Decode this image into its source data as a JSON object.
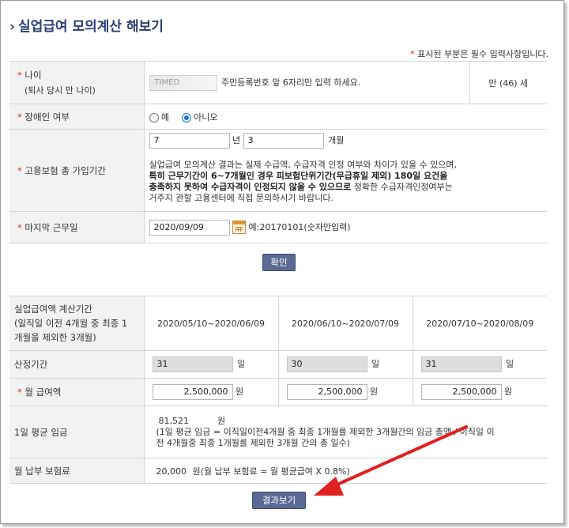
{
  "header": {
    "title": "실업급여 모의계산 해보기",
    "required_note": "표시된 부분은 필수 입력사항입니다."
  },
  "form": {
    "age": {
      "label": "나이",
      "sublabel": "(퇴사 당시 만 나이)",
      "masked_value": "TIMED",
      "help": "주민등록번호 앞 6자리만 입력 하세요.",
      "result": "만 (46) 세"
    },
    "disability": {
      "label": "장애인 여부",
      "options": [
        "예",
        "아니오"
      ],
      "selected": "아니오"
    },
    "insurance_period": {
      "label": "고용보험 총 가입기간",
      "years": "7",
      "years_unit": "년",
      "months": "3",
      "months_unit": "개월",
      "info_plain_1": "실업급여 모의계산 결과는 실제 수급액, 수급자격 인정 여부와 차이가 있을 수 있으며,",
      "info_bold_1": "특히 근무기간이 6~7개월인 경우 피보험단위기간(무급휴일 제외) 180일 요건을",
      "info_bold_2": "충족하지 못하여 수급자격이 인정되지 않을 수 있으므로",
      "info_plain_2": "정확한 수급자격인정여부는",
      "info_plain_3": "거주지 관할 고용센터에 직접 문의하시기 바랍니다."
    },
    "last_workday": {
      "label": "마지막 근무일",
      "value": "2020/09/09",
      "example": "예:20170101(숫자만입력)",
      "calendar_icon": "calendar-icon"
    },
    "confirm_label": "확인"
  },
  "calc": {
    "period_label_1": "실업급여액 계산기간",
    "period_label_2": "(일직일 이전 4개월 중 최종 1",
    "period_label_3": "개월을 제외한 3개월)",
    "periods": [
      "2020/05/10~2020/06/09",
      "2020/06/10~2020/07/09",
      "2020/07/10~2020/08/09"
    ],
    "days_label": "산정기간",
    "days": [
      "31",
      "30",
      "31"
    ],
    "days_unit": "일",
    "wage_label": "월 급여액",
    "wages": [
      "2,500,000",
      "2,500,000",
      "2,500,000"
    ],
    "wage_unit": "원",
    "avg_label": "1일 평균 임금",
    "avg_value": "81,521",
    "avg_unit": "원",
    "avg_desc_1": "(1일 평균 임금 = 이직일이전4개월 중 최종 1개월를 제외한 3개월간의 임금 총액 / 이직일 이",
    "avg_desc_2": "전 4개월중 최종 1개월를 제외한 3개월 간의 총 일수)",
    "premium_label": "월 납부 보험료",
    "premium_value": "20,000",
    "premium_desc": "원(월 납부 보험료 = 월 평균급여 X 0.8%)",
    "result_label": "결과보기"
  },
  "colors": {
    "accent": "#2c3e73",
    "button": "#5b6a94",
    "required": "#dd2222",
    "arrow": "#e02020"
  }
}
